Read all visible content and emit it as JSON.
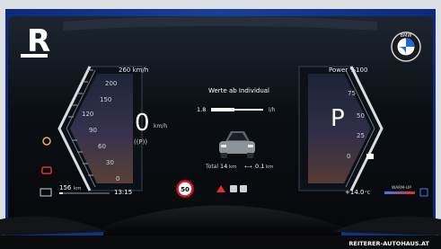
{
  "watermark": {
    "logo_letter": "R",
    "site": "REITERER-AUTOHAUS.AT"
  },
  "brand": {
    "logo_text": "BMW"
  },
  "speedometer": {
    "unit_label": "260 km/h",
    "ticks": [
      "200",
      "150",
      "120",
      "90",
      "60",
      "30",
      "0"
    ],
    "speed_value": "0",
    "speed_unit": "km/h",
    "park_indicator": "((P))"
  },
  "power_meter": {
    "title": "Power %100",
    "ticks": [
      "75",
      "50",
      "25",
      "0"
    ],
    "gear": "P"
  },
  "center": {
    "info_title": "Werte ab Individual",
    "consumption_value": "1.8",
    "consumption_unit": "l/h",
    "total_label": "Total",
    "total_value": "14",
    "total_unit": "km",
    "range_value": "0.1",
    "range_unit": "km"
  },
  "status": {
    "range_value": "156",
    "range_unit": "km",
    "clock": "13:15",
    "speed_limit": "50",
    "outside_temp": "+14.0",
    "temp_unit": "°C",
    "warmup_label": "WARM-UP"
  },
  "colors": {
    "display_bg": "#0b0f14",
    "frame_blue": "#1b3f9a",
    "accent_white": "#ffffff",
    "limit_red": "#d4141c",
    "warn_red": "#e0302a",
    "amber": "#e6b43a"
  }
}
